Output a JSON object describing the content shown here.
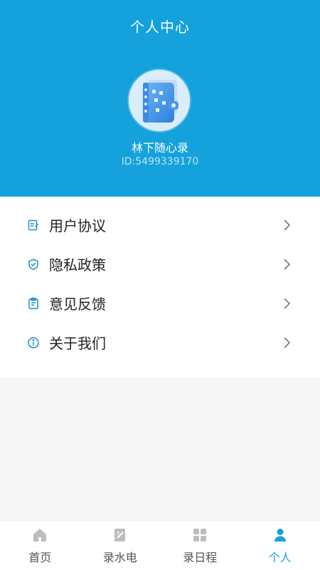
{
  "header": {
    "title": "个人中心"
  },
  "profile": {
    "name": "林下随心录",
    "id_text": "ID:5499339170",
    "avatar_icon": "notebook-avatar-icon"
  },
  "menu": [
    {
      "label": "用户协议",
      "icon": "edit-doc-icon"
    },
    {
      "label": "隐私政策",
      "icon": "shield-check-icon"
    },
    {
      "label": "意见反馈",
      "icon": "clipboard-icon"
    },
    {
      "label": "关于我们",
      "icon": "info-icon"
    }
  ],
  "tabbar": [
    {
      "label": "首页",
      "icon": "home-icon",
      "active": false
    },
    {
      "label": "录水电",
      "icon": "note-edit-icon",
      "active": false
    },
    {
      "label": "录日程",
      "icon": "grid-icon",
      "active": false
    },
    {
      "label": "个人",
      "icon": "person-icon",
      "active": true
    }
  ],
  "colors": {
    "primary": "#14a1dc",
    "icon_blue": "#1c8fc7",
    "inactive_icon": "#b9b9b9"
  }
}
